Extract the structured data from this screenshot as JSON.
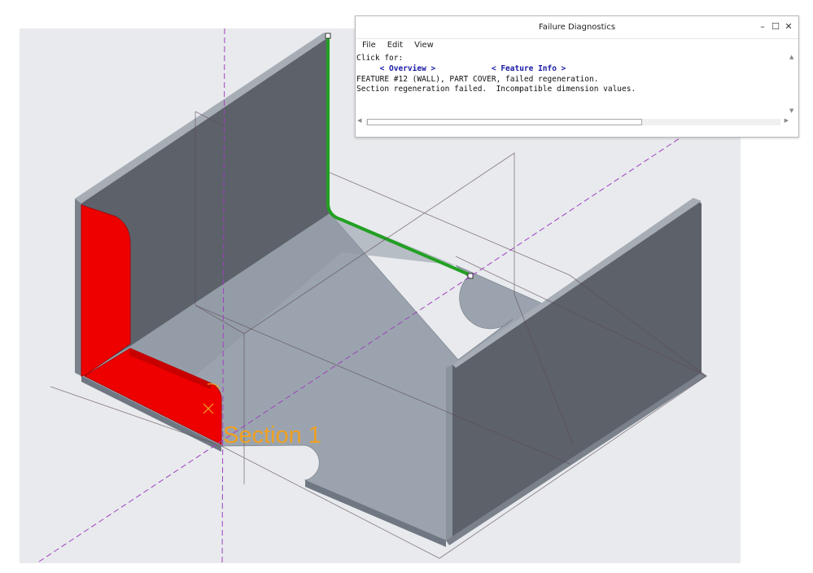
{
  "window": {
    "title": "Failure Diagnostics",
    "controls": {
      "minimize": "–",
      "maximize": "☐",
      "close": "✕"
    },
    "menu": [
      "File",
      "Edit",
      "View"
    ],
    "lines": {
      "click_for": "Click for:",
      "overview_link": "< Overview >",
      "feature_info_link": "< Feature Info >",
      "feature_msg": "FEATURE #12 (WALL), PART COVER, failed regeneration.",
      "section_msg": "Section regeneration failed.  Incompatible dimension values."
    }
  },
  "viewport": {
    "section_label": "Section 1",
    "background_color": "#e8eaed",
    "model_color": "#9aa3ad",
    "wall_color": "#5c616a",
    "error_color": "#ee0000",
    "highlight_color": "#22a022",
    "label_color": "#f0a020"
  }
}
